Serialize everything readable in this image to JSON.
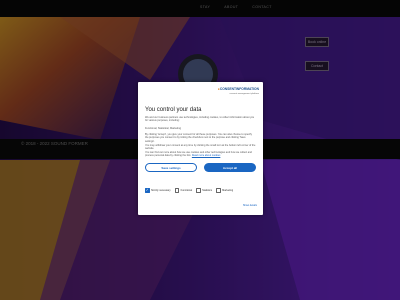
{
  "nav": {
    "items": [
      "STAY",
      "ABOUT",
      "CONTACT"
    ]
  },
  "header_buttons": {
    "primary": "Book online",
    "secondary": "Contact"
  },
  "footer": {
    "copyright": "© 2018 - 2022 SOUND FORMER"
  },
  "consent": {
    "logo": {
      "brand_a": "CONSENT",
      "brand_b": "INFORMATION",
      "sub": "consent management platform"
    },
    "title": "You control your data",
    "intro": "We and our business partners use technologies, including cookies, to collect information about you for various purposes, including:",
    "purposes": "Functional, Statistical, Marketing",
    "body": "By clicking 'Accept', you give your consent for all these purposes. You can also choose to specify the purposes you consent to by ticking the checkbox next to the purpose and clicking 'Save settings'.",
    "withdraw": "You may withdraw your consent at any time by clicking the small icon at the bottom left corner of the website.",
    "more_info": "You can find out more about how we use cookies and other technologies and how we collect and process personal data by clicking the link.",
    "more_link": "Read more about cookies",
    "btn_secondary": "Save settings",
    "btn_primary": "Accept all",
    "checkboxes": [
      {
        "label": "Strictly necessary",
        "checked": true
      },
      {
        "label": "Functional",
        "checked": false
      },
      {
        "label": "Statistics",
        "checked": false
      },
      {
        "label": "Marketing",
        "checked": false
      }
    ],
    "details": "Show details"
  },
  "colors": {
    "accent": "#1a66c2",
    "brand_orange": "#e07a14",
    "bg_purple": "#3a1a6a"
  }
}
